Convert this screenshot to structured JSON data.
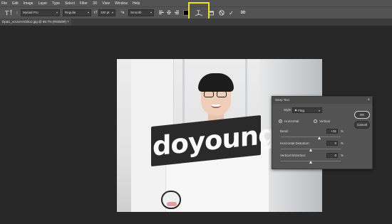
{
  "menu": [
    "File",
    "Edit",
    "Image",
    "Layer",
    "Type",
    "Select",
    "Filter",
    "3D",
    "View",
    "Window",
    "Help"
  ],
  "options": {
    "font_family": "Myriad Pro",
    "font_style": "Regular",
    "font_size": "100 pt",
    "anti_alias": "Smooth",
    "tool_icon": "text-tool-icon",
    "warp_icon": "warp-text-icon",
    "highlight_color": "#f1e21a"
  },
  "document_tab": {
    "title": "DpaC_vcUUAAGbUJ.jpg @ 66.7% (RGB/8#)",
    "close": "×"
  },
  "canvas": {
    "warped_text": "doyoung"
  },
  "warp_dialog": {
    "title": "Warp Text",
    "style_label": "Style:",
    "style_value": "Flag",
    "horizontal_label": "Horizontal",
    "vertical_label": "Vertical",
    "bend_label": "Bend:",
    "bend_value": "+31",
    "h_distortion_label": "Horizontal Distortion:",
    "h_distortion_value": "0",
    "v_distortion_label": "Vertical Distortion:",
    "v_distortion_value": "0",
    "percent": "%",
    "ok_label": "OK",
    "cancel_label": "Cancel",
    "orientation_selected": "Horizontal"
  }
}
